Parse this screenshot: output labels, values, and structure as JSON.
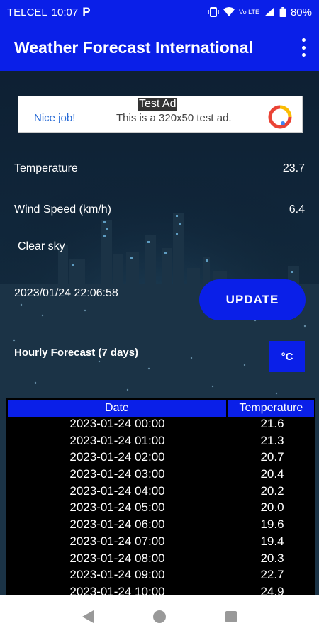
{
  "status_bar": {
    "carrier": "TELCEL",
    "time": "10:07",
    "app_badge": "P",
    "network": "Vo LTE",
    "battery": "80%"
  },
  "app_bar": {
    "title": "Weather Forecast International"
  },
  "ad": {
    "label": "Test Ad",
    "cta": "Nice job!",
    "text": "This is a 320x50 test ad."
  },
  "weather": {
    "temperature_label": "Temperature",
    "temperature_value": "23.7",
    "wind_label": "Wind Speed (km/h)",
    "wind_value": "6.4",
    "condition": "Clear sky",
    "timestamp": "2023/01/24 22:06:58",
    "update_label": "UPDATE",
    "forecast_label": "Hourly Forecast (7 days)",
    "unit_label": "°C"
  },
  "table": {
    "headers": [
      "Date",
      "Temperature"
    ],
    "rows": [
      [
        "2023-01-24 00:00",
        "21.6"
      ],
      [
        "2023-01-24 01:00",
        "21.3"
      ],
      [
        "2023-01-24 02:00",
        "20.7"
      ],
      [
        "2023-01-24 03:00",
        "20.4"
      ],
      [
        "2023-01-24 04:00",
        "20.2"
      ],
      [
        "2023-01-24 05:00",
        "20.0"
      ],
      [
        "2023-01-24 06:00",
        "19.6"
      ],
      [
        "2023-01-24 07:00",
        "19.4"
      ],
      [
        "2023-01-24 08:00",
        "20.3"
      ],
      [
        "2023-01-24 09:00",
        "22.7"
      ],
      [
        "2023-01-24 10:00",
        "24.9"
      ]
    ]
  },
  "colors": {
    "primary": "#0a1fe8",
    "table_bg": "#000000"
  }
}
